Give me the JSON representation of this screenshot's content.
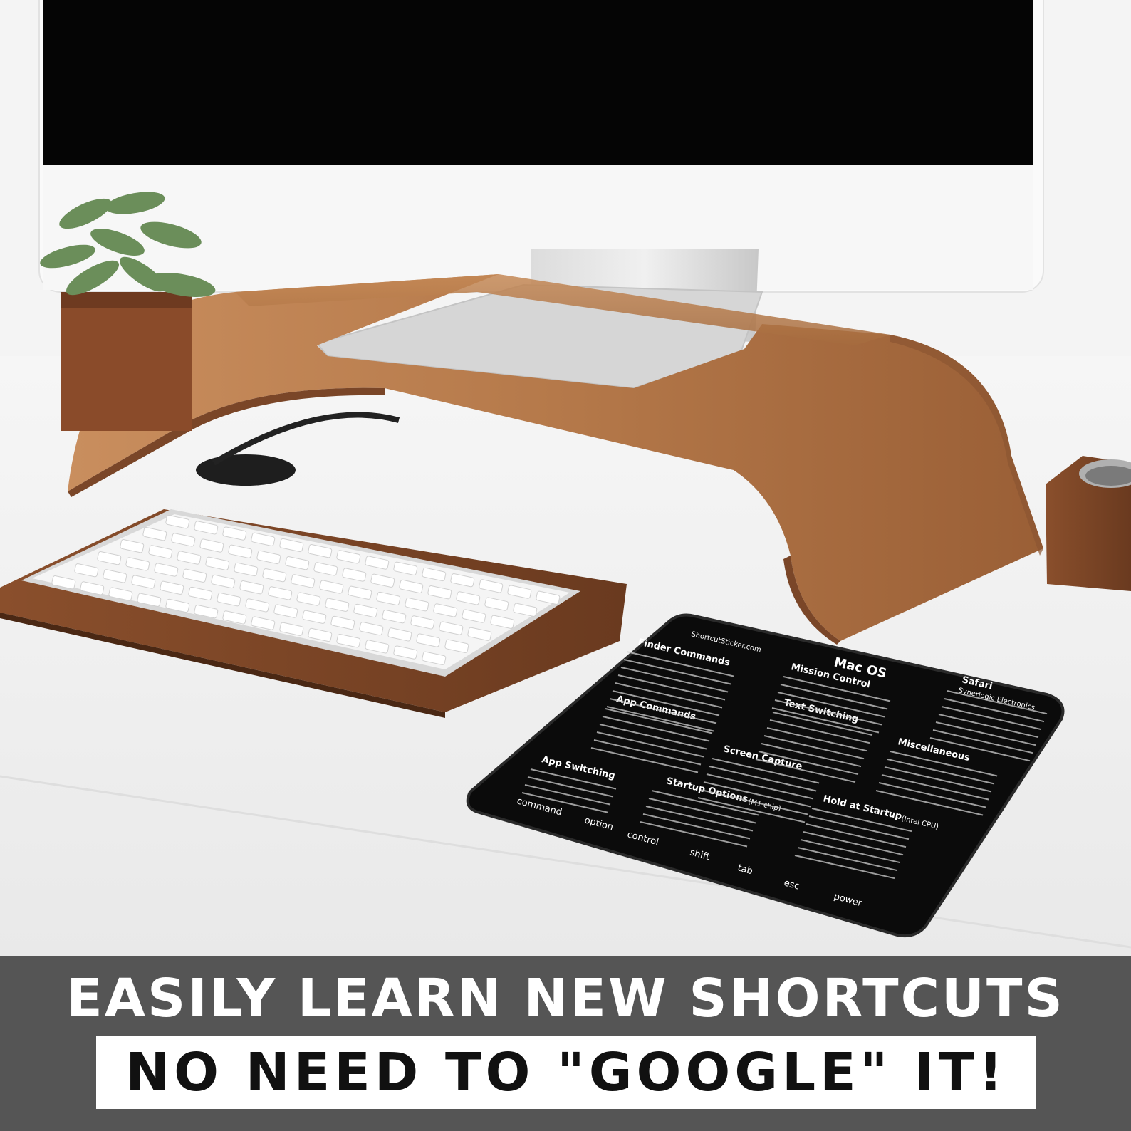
{
  "banner": {
    "headline": "EASILY LEARN NEW SHORTCUTS",
    "subline": "NO NEED TO \"GOOGLE\" IT!"
  },
  "mousepad": {
    "title": "Mac OS",
    "site": "ShortcutSticker.com",
    "brand": "Synerlogic Electronics",
    "sections": {
      "finder": "Finder Commands",
      "mission": "Mission Control",
      "text": "Text Switching",
      "safari": "Safari",
      "app_commands": "App Commands",
      "screen_capture": "Screen Capture",
      "misc": "Miscellaneous",
      "app_switching": "App Switching",
      "startup_options": "Startup Options",
      "startup_note": "(M1 chip)",
      "hold_startup": "Hold at Startup",
      "hold_note": "(Intel CPU)"
    },
    "keys": {
      "command": "command",
      "option": "option",
      "control": "control",
      "shift": "shift",
      "tab": "tab",
      "esc": "esc",
      "power": "power"
    }
  },
  "colors": {
    "banner": "#555555",
    "mat": "#0b0b0b",
    "wood": "#b5794a"
  }
}
